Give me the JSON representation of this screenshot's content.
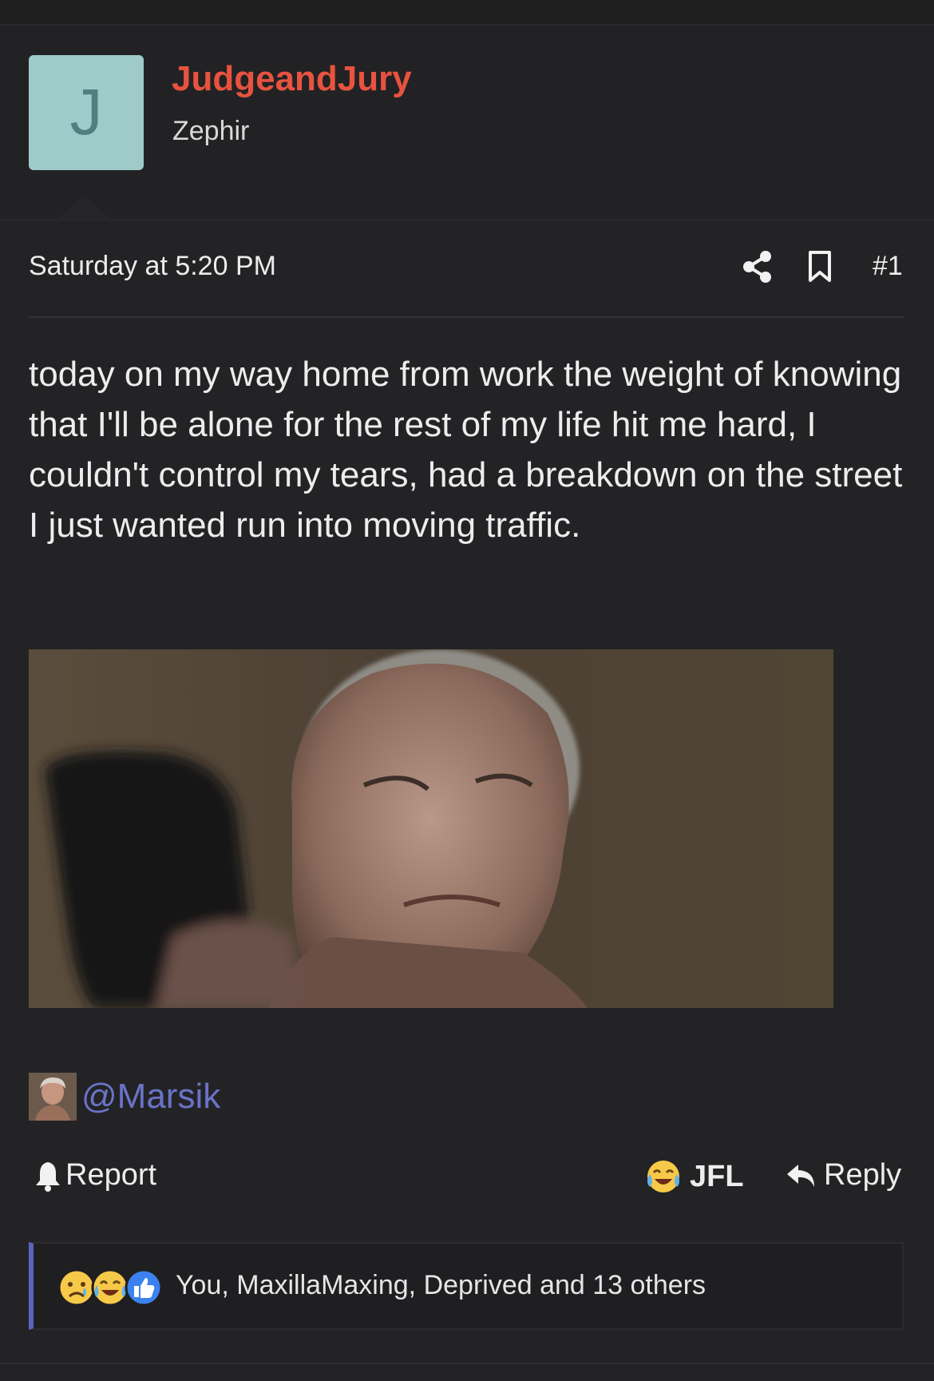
{
  "user": {
    "avatar_letter": "J",
    "name": "JudgeandJury",
    "title": "Zephir",
    "name_color": "#e8533f",
    "avatar_bg": "#9ecaca"
  },
  "post": {
    "date": "Saturday at 5:20 PM",
    "number": "#1",
    "body": "today on my way home from work the weight of knowing that I'll be alone for the rest of my life hit me hard, I couldn't control my tears, had a breakdown on the street I just wanted run into moving traffic.",
    "mention": "@Marsik",
    "mention_color": "#6a73c8"
  },
  "icons": {
    "share": "share-icon",
    "bookmark": "bookmark-icon",
    "report": "bell-icon",
    "jfl": "crying-laughing-emoji-icon",
    "reply": "reply-arrow-icon"
  },
  "actions": {
    "report_label": "Report",
    "jfl_label": "JFL",
    "reply_label": "Reply"
  },
  "reactions": {
    "icons": [
      "sad-emoji-icon",
      "crying-laughing-emoji-icon",
      "thumbs-up-icon"
    ],
    "summary": "You, MaxillaMaxing, Deprived and 13 others",
    "accent_color": "#5b63bf"
  }
}
